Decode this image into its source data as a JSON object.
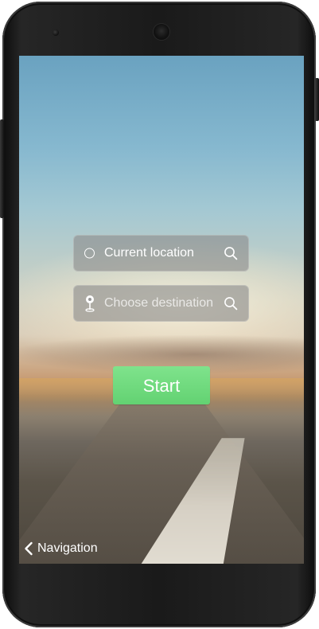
{
  "screen": {
    "current_location": {
      "label": "Current location",
      "icon": "ring-icon",
      "action_icon": "search-icon"
    },
    "destination": {
      "placeholder": "Choose destination",
      "icon": "map-pin-icon",
      "action_icon": "search-icon"
    },
    "start_button": {
      "label": "Start",
      "color": "#6ad97a"
    },
    "back_nav": {
      "icon": "chevron-left-icon",
      "label": "Navigation"
    }
  }
}
